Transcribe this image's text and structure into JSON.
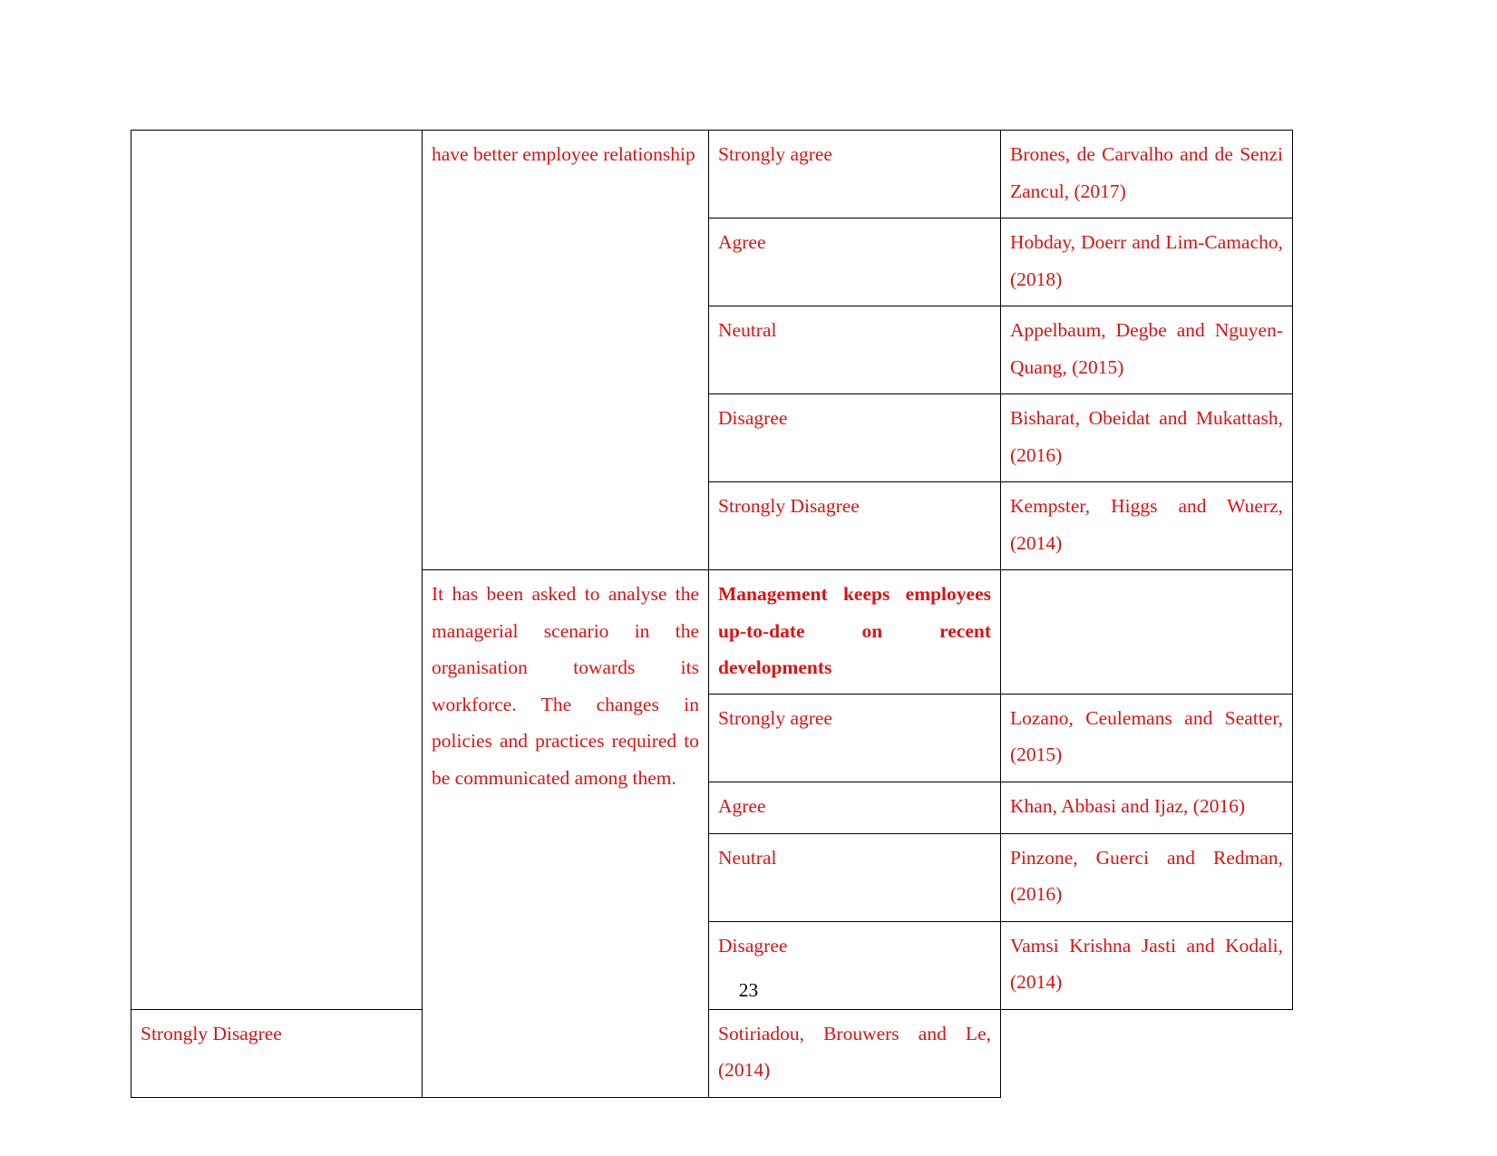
{
  "document": {
    "page_number": "23",
    "text_color": "#e01010",
    "border_color": "#000000",
    "page_number_color": "#000000"
  },
  "table": {
    "sections": [
      {
        "blank_cell": "",
        "question": "have better employee relationship",
        "question_bold": false,
        "rows": [
          {
            "option": "Strongly agree",
            "citation": "Brones, de Carvalho and de Senzi Zancul, (2017)"
          },
          {
            "option": "Agree",
            "citation": "Hobday, Doerr and Lim-Camacho, (2018)"
          },
          {
            "option": "Neutral",
            "citation": "Appelbaum, Degbe and Nguyen-Quang, (2015)"
          },
          {
            "option": "Disagree",
            "citation": "Bisharat, Obeidat and Mukattash, (2016)"
          },
          {
            "option": "Strongly Disagree",
            "citation": "Kempster, Higgs and Wuerz, (2014)"
          }
        ]
      },
      {
        "blank_cell": "",
        "question": "It has been asked to analyse the managerial scenario in the organisation towards its workforce. The changes in policies and practices required to be communicated among them.",
        "statement_heading": "Management keeps employees up-to-date on recent developments",
        "statement_citation": "",
        "rows": [
          {
            "option": "Strongly agree",
            "citation": "Lozano, Ceulemans and Seatter, (2015)"
          },
          {
            "option": "Agree",
            "citation": "Khan, Abbasi and Ijaz, (2016)"
          },
          {
            "option": "Neutral",
            "citation": "Pinzone, Guerci and Redman, (2016)"
          },
          {
            "option": "Disagree",
            "citation": "Vamsi Krishna Jasti and Kodali, (2014)"
          },
          {
            "option": "Strongly Disagree",
            "citation": "Sotiriadou, Brouwers and Le, (2014)"
          }
        ]
      }
    ]
  }
}
